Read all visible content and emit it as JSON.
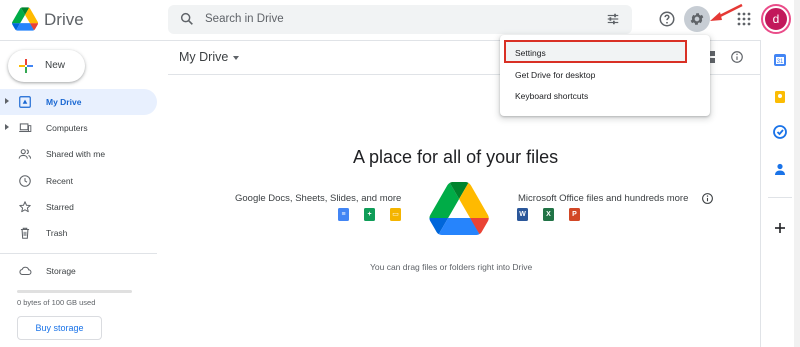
{
  "header": {
    "brand": "Drive",
    "search_placeholder": "Search in Drive",
    "avatar_initial": "d"
  },
  "sidebar": {
    "new_label": "New",
    "items": [
      {
        "label": "My Drive",
        "icon": "my-drive-icon",
        "active": true
      },
      {
        "label": "Computers",
        "icon": "computer-icon",
        "active": false
      },
      {
        "label": "Shared with me",
        "icon": "people-icon",
        "active": false
      },
      {
        "label": "Recent",
        "icon": "clock-icon",
        "active": false
      },
      {
        "label": "Starred",
        "icon": "star-icon",
        "active": false
      },
      {
        "label": "Trash",
        "icon": "trash-icon",
        "active": false
      }
    ],
    "storage_label": "Storage",
    "storage_text": "0 bytes of 100 GB used",
    "storage_used_fraction": 0,
    "buy_storage": "Buy storage"
  },
  "main": {
    "title": "My Drive",
    "headline": "A place for all of your files",
    "left_caption": "Google Docs, Sheets, Slides, and more",
    "right_caption": "Microsoft Office files and hundreds more",
    "hint": "You can drag files or folders right into Drive",
    "ms_icons": [
      "W",
      "X",
      "P"
    ]
  },
  "settings_menu": {
    "items": [
      "Settings",
      "Get Drive for desktop",
      "Keyboard shortcuts"
    ],
    "highlighted": "Settings"
  },
  "colors": {
    "accent_blue": "#1a73e8",
    "highlight_red": "#d93025",
    "active_bg": "#e8f0fe"
  }
}
